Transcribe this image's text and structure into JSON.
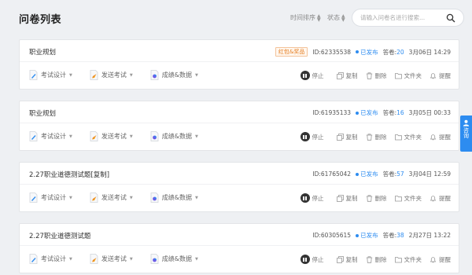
{
  "header": {
    "title": "问卷列表",
    "sort_time": "时间排序",
    "sort_status": "状态",
    "search_placeholder": "请输入问卷名进行搜索..."
  },
  "tools": {
    "design": "考试设计",
    "send": "发送考试",
    "results": "成绩&数据"
  },
  "actions": {
    "stop": "停止",
    "copy": "复制",
    "delete": "删除",
    "folder": "文件夹",
    "remind": "提醒"
  },
  "labels": {
    "answers": "答卷:"
  },
  "surveys": [
    {
      "title": "职业规划",
      "badge": "红包&奖品",
      "id": "ID:62335538",
      "status": "已发布",
      "answers": "20",
      "date": "3月06日 14:29"
    },
    {
      "title": "职业规划",
      "badge": "",
      "id": "ID:61935133",
      "status": "已发布",
      "answers": "16",
      "date": "3月05日 00:33"
    },
    {
      "title": "2.27职业道德测试题[复制]",
      "badge": "",
      "id": "ID:61765042",
      "status": "已发布",
      "answers": "57",
      "date": "3月04日 12:59"
    },
    {
      "title": "2.27职业道德测试题",
      "badge": "",
      "id": "ID:60305615",
      "status": "已发布",
      "answers": "38",
      "date": "2月27日 13:22"
    }
  ],
  "side_tab": {
    "label": "咨询"
  },
  "colors": {
    "accent": "#2d8cf0",
    "badge": "#e67e22",
    "background": "#eef0f3"
  }
}
